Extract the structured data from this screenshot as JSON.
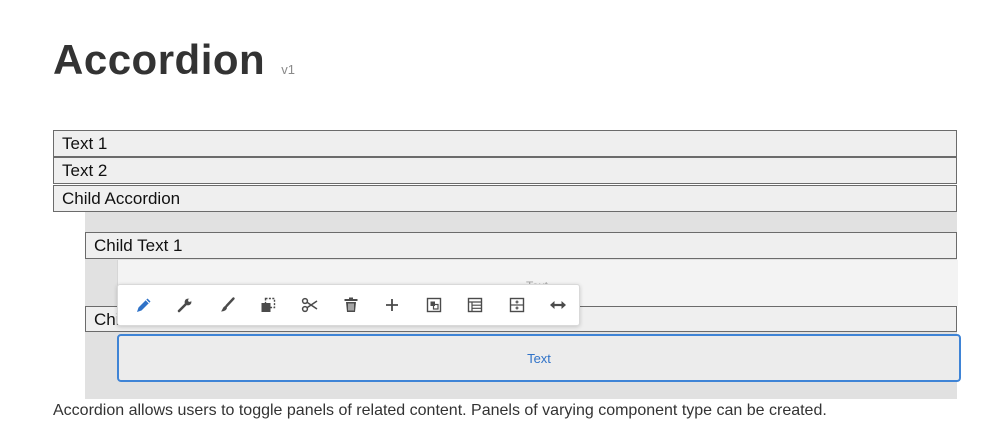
{
  "page": {
    "title": "Accordion",
    "version": "v1"
  },
  "accordion": {
    "items": [
      "Text 1",
      "Text 2",
      "Child Accordion"
    ],
    "child_items": [
      "Child Text 1",
      "Chi"
    ]
  },
  "placeholder": {
    "label": "Text"
  },
  "selected": {
    "label": "Text"
  },
  "toolbar": {
    "tools": [
      "edit-icon",
      "configure-icon",
      "style-icon",
      "copy-icon",
      "cut-icon",
      "delete-icon",
      "insert-icon",
      "parent-icon",
      "layout-icon",
      "group-icon",
      "resize-icon"
    ]
  },
  "description": "Accordion allows users to toggle panels of related content. Panels of varying component type can be created.",
  "colors": {
    "selection": "#3f84d6",
    "accent": "#2f72c8"
  }
}
